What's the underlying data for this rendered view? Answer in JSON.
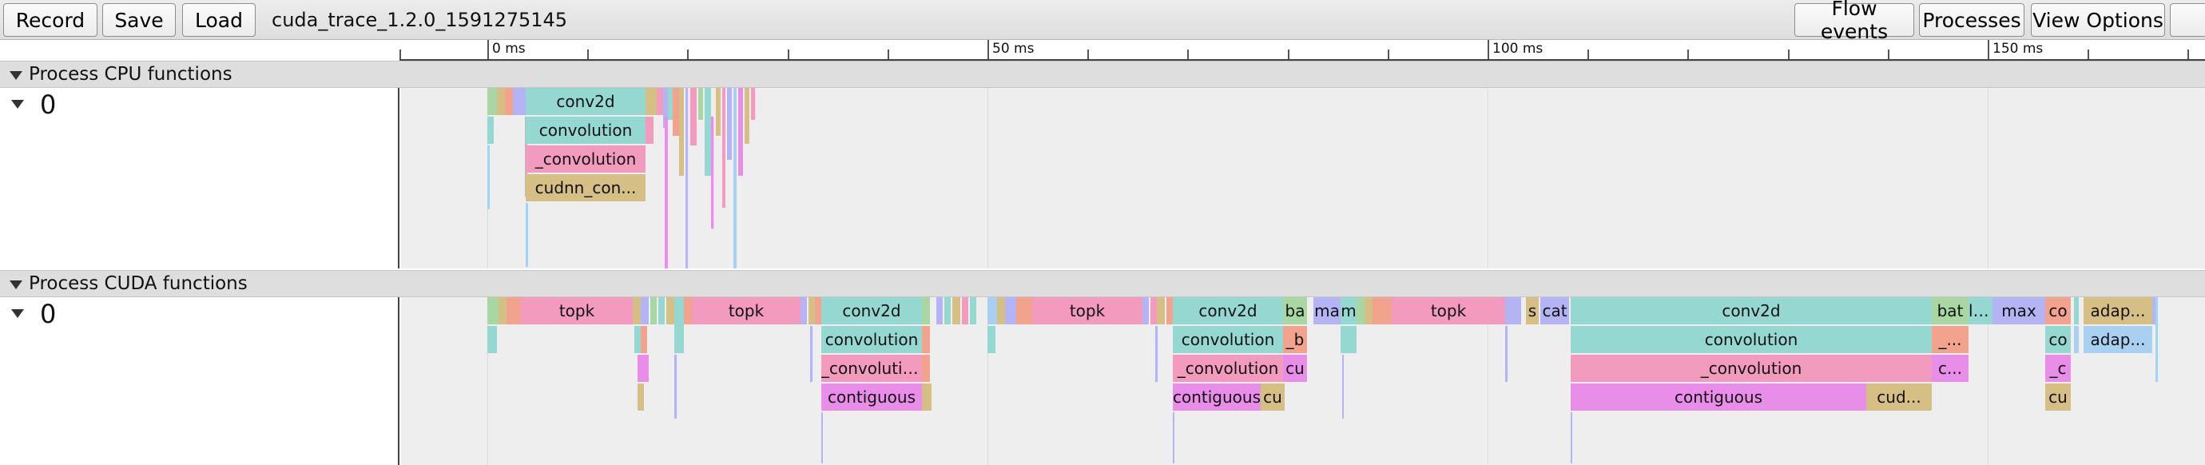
{
  "toolbar": {
    "record_label": "Record",
    "save_label": "Save",
    "load_label": "Load",
    "trace_title": "cuda_trace_1.2.0_1591275145",
    "flow_events_label": "Flow events",
    "processes_label": "Processes",
    "view_options_label": "View Options"
  },
  "ruler": {
    "ticks": [
      "0 ms",
      "50 ms",
      "100 ms",
      "150 ms"
    ]
  },
  "colors": {
    "teal": "#95d8d2",
    "pink": "#f29bbe",
    "tan": "#d6bf84",
    "violet": "#e98ee8",
    "lavender": "#b4b4f4",
    "green": "#a9d7a4",
    "salmon": "#f1a38e",
    "blue": "#a9cff1",
    "track_bg": "#eeeeee"
  },
  "cpu_process": {
    "name": "Process CPU functions",
    "thread": "0",
    "slices": [
      {
        "label": "conv2d",
        "color": "teal"
      },
      {
        "label": "convolution",
        "color": "teal"
      },
      {
        "label": "_convolution",
        "color": "pink"
      },
      {
        "label": "cudnn_con...",
        "color": "tan"
      }
    ]
  },
  "cuda_process": {
    "name": "Process CUDA functions",
    "thread": "0",
    "slices": [
      {
        "label": "topk",
        "color": "pink"
      },
      {
        "label": "topk",
        "color": "pink"
      },
      {
        "label": "conv2d",
        "color": "teal"
      },
      {
        "label": "convolution",
        "color": "teal"
      },
      {
        "label": "_convolution",
        "color": "pink"
      },
      {
        "label": "contiguous",
        "color": "violet"
      },
      {
        "label": "topk",
        "color": "pink"
      },
      {
        "label": "conv2d",
        "color": "teal"
      },
      {
        "label": "convolution",
        "color": "teal"
      },
      {
        "label": "_convolution",
        "color": "pink"
      },
      {
        "label": "contiguous",
        "color": "violet"
      },
      {
        "label": "ba",
        "color": "green"
      },
      {
        "label": "_b",
        "color": "salmon"
      },
      {
        "label": "cu",
        "color": "violet"
      },
      {
        "label": "cu",
        "color": "tan"
      },
      {
        "label": "ma",
        "color": "lavender"
      },
      {
        "label": "m",
        "color": "teal"
      },
      {
        "label": "topk",
        "color": "pink"
      },
      {
        "label": "s",
        "color": "tan"
      },
      {
        "label": "cat",
        "color": "lavender"
      },
      {
        "label": "conv2d",
        "color": "teal"
      },
      {
        "label": "convolution",
        "color": "teal"
      },
      {
        "label": "_convolution",
        "color": "pink"
      },
      {
        "label": "contiguous",
        "color": "violet"
      },
      {
        "label": "cud...",
        "color": "tan"
      },
      {
        "label": "bat",
        "color": "green"
      },
      {
        "label": "_...",
        "color": "salmon"
      },
      {
        "label": "c...",
        "color": "violet"
      },
      {
        "label": "lea",
        "color": "teal"
      },
      {
        "label": "max",
        "color": "lavender"
      },
      {
        "label": "co",
        "color": "salmon"
      },
      {
        "label": "co",
        "color": "teal"
      },
      {
        "label": "_c",
        "color": "violet"
      },
      {
        "label": "cu",
        "color": "tan"
      },
      {
        "label": "adap...",
        "color": "tan"
      },
      {
        "label": "adap...",
        "color": "blue"
      }
    ]
  }
}
